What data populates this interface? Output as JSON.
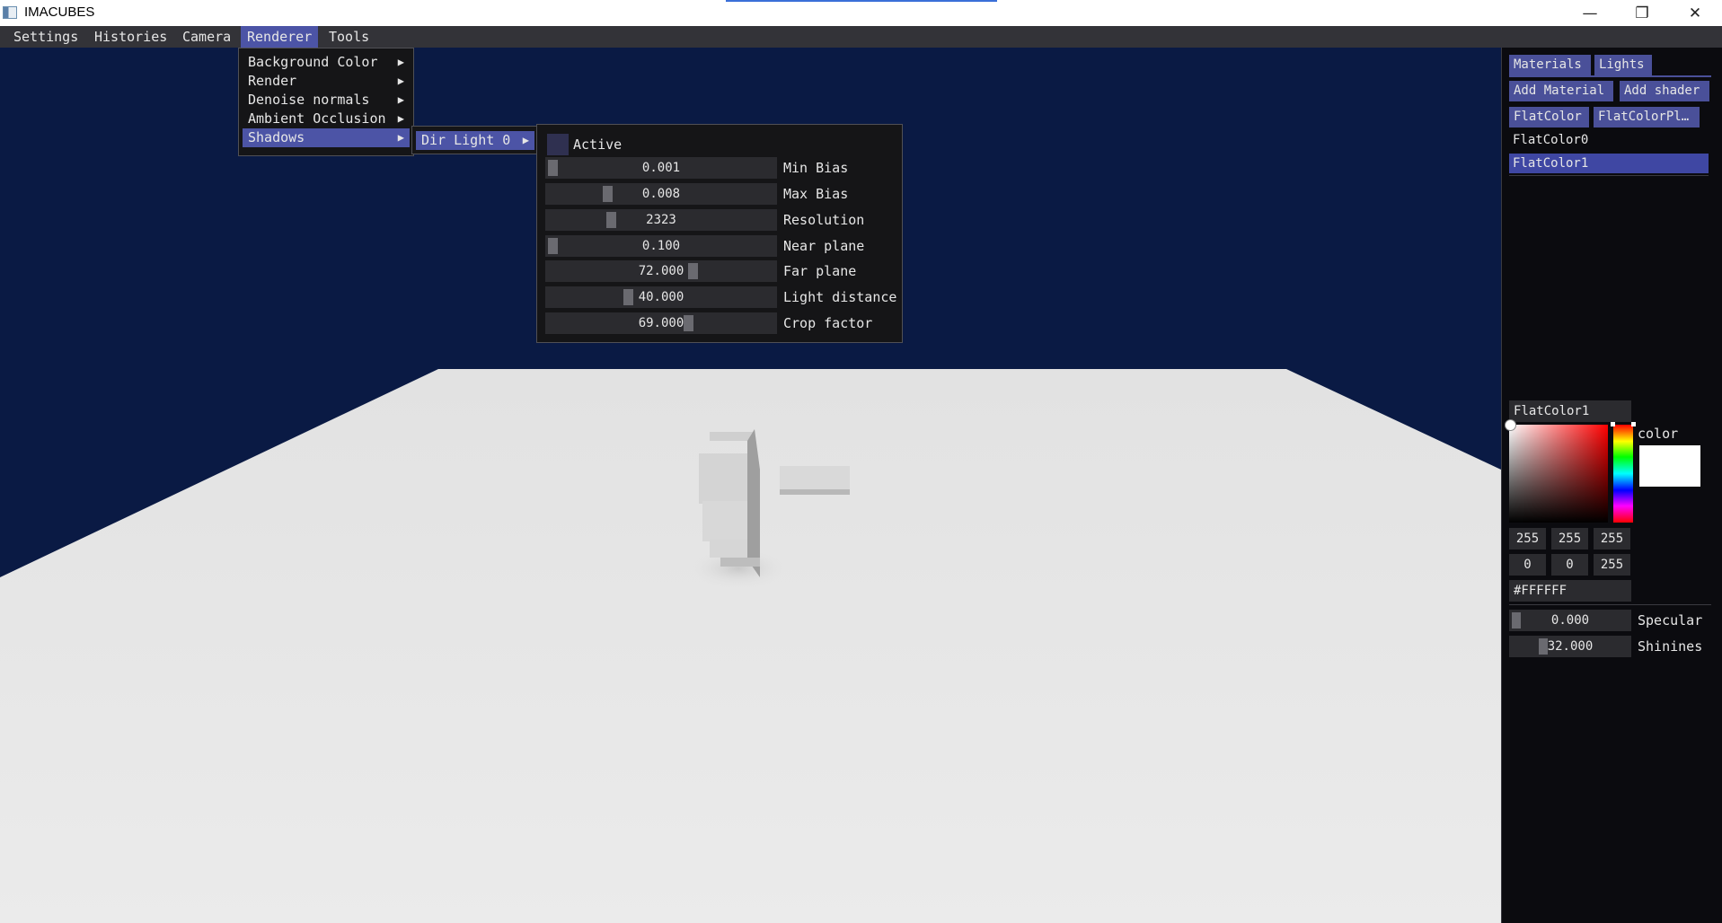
{
  "window": {
    "title": "IMACUBES",
    "minimize_glyph": "—",
    "restore_glyph": "❐",
    "close_glyph": "✕"
  },
  "menubar": {
    "items": [
      "Settings",
      "Histories",
      "Camera",
      "Renderer",
      "Tools"
    ],
    "active": "Renderer"
  },
  "renderer_menu": {
    "items": [
      "Background Color",
      "Render",
      "Denoise normals",
      "Ambient Occlusion",
      "Shadows"
    ],
    "selected": "Shadows",
    "arrow_glyph": "▶"
  },
  "shadows_menu": {
    "items": [
      "Dir Light 0"
    ],
    "selected": "Dir Light 0"
  },
  "dir_light_panel": {
    "active_label": "Active",
    "active_checked": false,
    "sliders": [
      {
        "value": "0.001",
        "label": "Min Bias",
        "level": 0.0
      },
      {
        "value": "0.008",
        "label": "Max Bias",
        "level": 0.26
      },
      {
        "value": "2323",
        "label": "Resolution",
        "level": 0.28
      },
      {
        "value": "0.100",
        "label": "Near plane",
        "level": 0.0
      },
      {
        "value": "72.000",
        "label": "Far plane",
        "level": 0.67
      },
      {
        "value": "40.000",
        "label": "Light distance",
        "level": 0.36
      },
      {
        "value": "69.000",
        "label": "Crop factor",
        "level": 0.65
      }
    ]
  },
  "right_panel": {
    "tabs": [
      "Materials",
      "Lights"
    ],
    "actions": [
      "Add Material",
      "Add shader"
    ],
    "shader_tabs": [
      "FlatColor",
      "FlatColorPl…"
    ],
    "materials": [
      "FlatColor0",
      "FlatColor1"
    ],
    "selected_material": "FlatColor1",
    "name_field": "FlatColor1",
    "color_label": "color",
    "color_hex": "#FFFFFF",
    "hue_base": "#ff0000",
    "rgb_values": [
      "255",
      "255",
      "255"
    ],
    "hsv_values": [
      "0",
      "0",
      "255"
    ],
    "hex_field": "#FFFFFF",
    "properties": [
      {
        "value": "0.000",
        "label": "Specular",
        "level": 0.0
      },
      {
        "value": "32.000",
        "label": "Shinines",
        "level": 0.25
      }
    ]
  },
  "colors": {
    "sky": "#0a1a44",
    "floor": "#e6e6e6",
    "menu_accent": "#4c54a6",
    "panel_bg": "#0b0b0f"
  },
  "icons": [
    "app-icon",
    "minimize-icon",
    "restore-icon",
    "close-icon",
    "submenu-arrow-icon",
    "checkbox-icon",
    "color-picker-icon",
    "hue-bar-icon"
  ]
}
